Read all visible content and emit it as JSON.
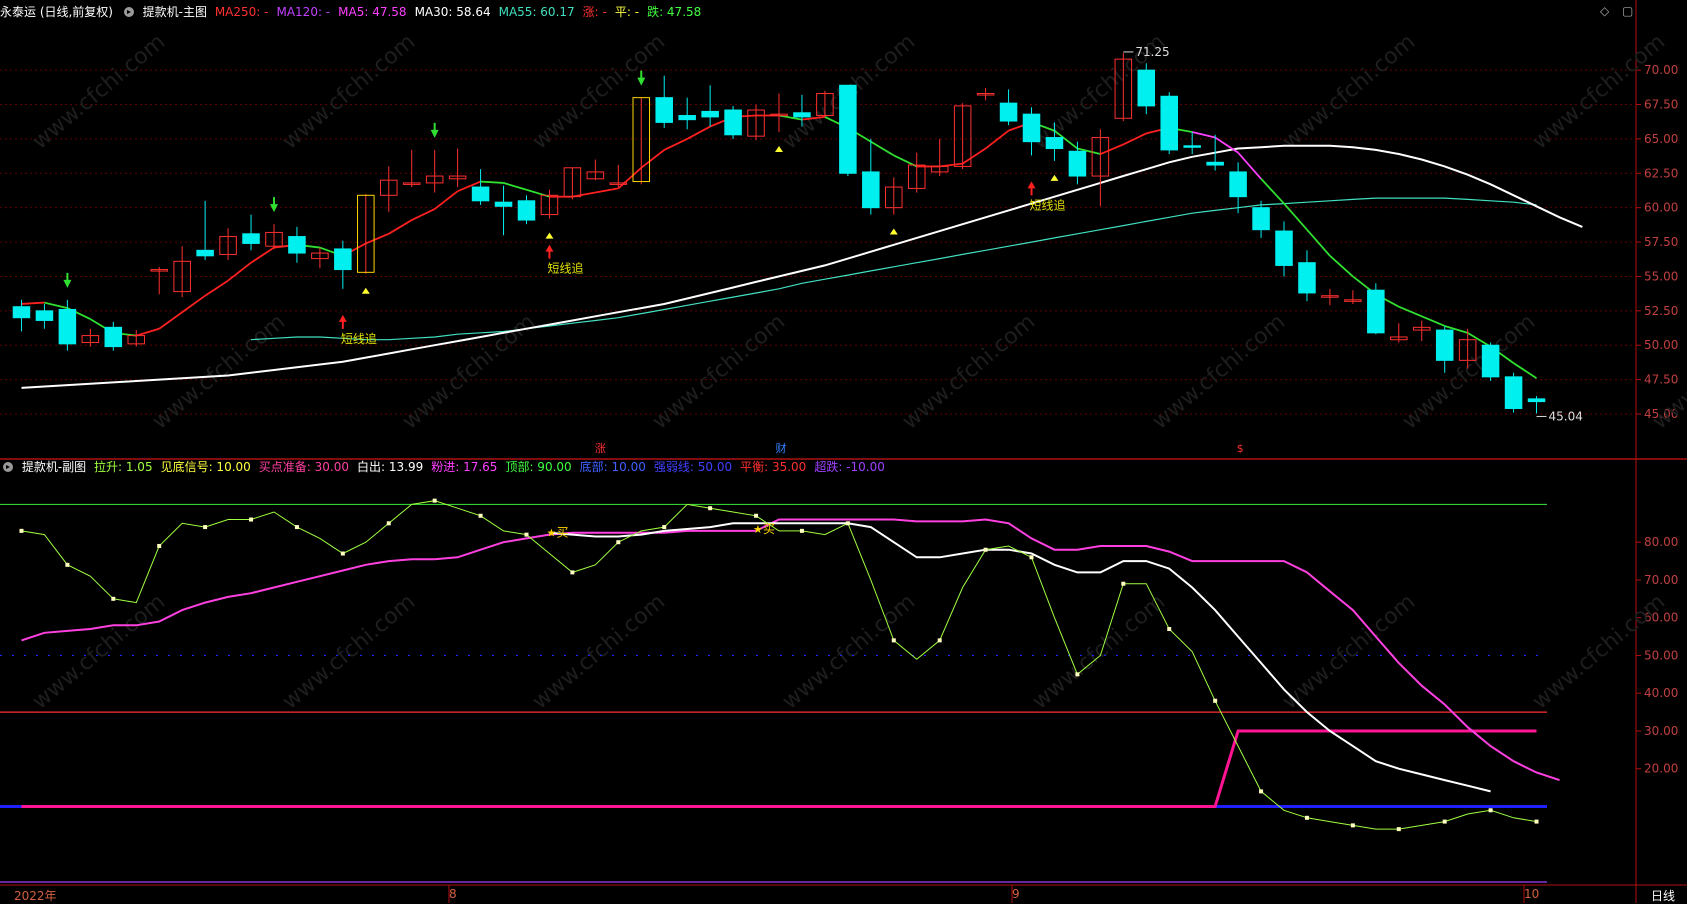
{
  "main_header": {
    "stock": "永泰运 (日线,前复权)",
    "indicator": "提款机-主图",
    "items": [
      {
        "text": "MA250: -",
        "color": "#ff3030"
      },
      {
        "text": "MA120: -",
        "color": "#c040ff"
      },
      {
        "text": "MA5: 47.58",
        "color": "#ff40ff"
      },
      {
        "text": "MA30: 58.64",
        "color": "#ffffff"
      },
      {
        "text": "MA55: 60.17",
        "color": "#40e0c0"
      },
      {
        "text": "涨: -",
        "color": "#ff3030"
      },
      {
        "text": "平: -",
        "color": "#ffff40"
      },
      {
        "text": "跌: 47.58",
        "color": "#40ff40"
      }
    ]
  },
  "sub_header": {
    "indicator": "提款机-副图",
    "items": [
      {
        "text": "拉升: 1.05",
        "color": "#a0ff40"
      },
      {
        "text": "见底信号: 10.00",
        "color": "#ffff40"
      },
      {
        "text": "买点准备: 30.00",
        "color": "#ff40a0"
      },
      {
        "text": "白出: 13.99",
        "color": "#ffffff"
      },
      {
        "text": "粉进: 17.65",
        "color": "#ff40ff"
      },
      {
        "text": "顶部: 90.00",
        "color": "#40ff40"
      },
      {
        "text": "底部: 10.00",
        "color": "#4060ff"
      },
      {
        "text": "强弱线: 50.00",
        "color": "#4040ff"
      },
      {
        "text": "平衡: 35.00",
        "color": "#ff3030"
      },
      {
        "text": "超跌: -10.00",
        "color": "#a040ff"
      }
    ]
  },
  "window_buttons": {
    "diamond": "◇",
    "restore": "▢"
  },
  "bottom_axis": {
    "year": "2022年",
    "m8": "8",
    "m9": "9",
    "m10": "10",
    "period": "日线"
  },
  "markers": {
    "zhang": "涨",
    "cai": "财",
    "s": "$"
  },
  "annotations": {
    "high": "71.25",
    "low": "45.04",
    "chase": "短线追",
    "buy": "买"
  },
  "watermark": "www.cfchi.com",
  "colors": {
    "up": "#ff3030",
    "down": "#00f0f0",
    "grid": "#600000",
    "axis": "#b01010",
    "tick": "#c04040"
  },
  "chart_data": [
    {
      "type": "candlestick",
      "title": "提款机-主图",
      "ylim": [
        41.8,
        73.5
      ],
      "y_ticks": [
        "70.00",
        "67.50",
        "65.00",
        "62.50",
        "60.00",
        "57.50",
        "55.00",
        "52.50",
        "50.00",
        "47.50",
        "45.00"
      ],
      "candles": [
        [
          52.8,
          52.0,
          53.3,
          51.0
        ],
        [
          52.5,
          51.8,
          53.0,
          51.2
        ],
        [
          52.6,
          50.1,
          53.3,
          49.6
        ],
        [
          50.2,
          50.7,
          51.2,
          49.9
        ],
        [
          51.3,
          49.9,
          51.7,
          49.6
        ],
        [
          50.1,
          50.7,
          51.1,
          49.9
        ],
        [
          55.5,
          55.5,
          55.7,
          53.7
        ],
        [
          53.9,
          56.1,
          57.2,
          53.5
        ],
        [
          56.9,
          56.5,
          60.5,
          56.2
        ],
        [
          56.6,
          57.9,
          58.5,
          56.2
        ],
        [
          58.1,
          57.4,
          59.5,
          56.9
        ],
        [
          57.2,
          58.2,
          58.8,
          57.0
        ],
        [
          57.9,
          56.7,
          58.6,
          56.0
        ],
        [
          56.3,
          56.7,
          57.1,
          55.6
        ],
        [
          57.0,
          55.5,
          57.6,
          54.1
        ],
        [
          55.3,
          60.9,
          61.0,
          55.2
        ],
        [
          60.9,
          62.0,
          63.0,
          59.7
        ],
        [
          61.7,
          61.8,
          64.2,
          61.5
        ],
        [
          61.8,
          62.3,
          64.2,
          61.1
        ],
        [
          62.1,
          62.3,
          64.3,
          61.5
        ],
        [
          61.5,
          60.5,
          62.8,
          60.2
        ],
        [
          60.4,
          60.1,
          61.6,
          58.0
        ],
        [
          60.5,
          59.1,
          60.9,
          58.8
        ],
        [
          59.5,
          60.9,
          61.3,
          59.2
        ],
        [
          60.8,
          62.9,
          62.9,
          60.6
        ],
        [
          62.1,
          62.6,
          63.5,
          62.0
        ],
        [
          61.8,
          61.8,
          63.1,
          61.5
        ],
        [
          61.9,
          68.0,
          68.0,
          61.7
        ],
        [
          68.0,
          66.2,
          69.6,
          65.8
        ],
        [
          66.7,
          66.4,
          68.0,
          65.7
        ],
        [
          67.0,
          66.6,
          68.9,
          65.9
        ],
        [
          67.1,
          65.3,
          67.4,
          65.0
        ],
        [
          65.2,
          67.1,
          67.5,
          64.9
        ],
        [
          66.7,
          66.8,
          68.3,
          65.5
        ],
        [
          66.9,
          66.6,
          68.2,
          65.9
        ],
        [
          66.7,
          68.3,
          68.5,
          66.6
        ],
        [
          68.9,
          62.5,
          68.9,
          62.3
        ],
        [
          62.6,
          60.0,
          65.0,
          59.5
        ],
        [
          60.0,
          61.5,
          62.2,
          59.5
        ],
        [
          61.4,
          63.1,
          64.0,
          61.1
        ],
        [
          62.6,
          63.0,
          65.0,
          62.3
        ],
        [
          63.0,
          67.4,
          67.6,
          62.8
        ],
        [
          68.3,
          68.3,
          68.7,
          67.8
        ],
        [
          67.6,
          66.3,
          68.6,
          66.0
        ],
        [
          66.8,
          64.8,
          67.3,
          63.8
        ],
        [
          65.1,
          64.3,
          66.2,
          63.4
        ],
        [
          64.1,
          62.3,
          64.8,
          61.7
        ],
        [
          62.3,
          65.1,
          65.7,
          60.1
        ],
        [
          66.5,
          70.8,
          71.25,
          66.3
        ],
        [
          70.0,
          67.4,
          70.5,
          66.8
        ],
        [
          68.1,
          64.2,
          68.4,
          63.9
        ],
        [
          64.5,
          64.4,
          65.5,
          63.9
        ],
        [
          63.3,
          63.1,
          65.3,
          62.7
        ],
        [
          62.6,
          60.8,
          63.3,
          59.6
        ],
        [
          60.0,
          58.4,
          60.5,
          57.8
        ],
        [
          58.3,
          55.8,
          59.0,
          55.0
        ],
        [
          56.0,
          53.8,
          56.9,
          53.2
        ],
        [
          53.5,
          53.6,
          54.1,
          52.9
        ],
        [
          53.2,
          53.3,
          54.0,
          53.0
        ],
        [
          54.0,
          50.9,
          54.5,
          50.8
        ],
        [
          50.4,
          50.6,
          51.6,
          50.2
        ],
        [
          51.1,
          51.3,
          51.8,
          50.3
        ],
        [
          51.1,
          48.9,
          51.4,
          48.0
        ],
        [
          48.9,
          50.4,
          51.2,
          48.3
        ],
        [
          50.0,
          47.7,
          50.2,
          47.4
        ],
        [
          47.7,
          45.4,
          48.0,
          45.1
        ],
        [
          46.1,
          45.9,
          46.3,
          45.04
        ]
      ],
      "series": [
        {
          "name": "MA5",
          "color_seq": true,
          "values": [
            53.0,
            53.1,
            52.7,
            51.9,
            50.9,
            50.7,
            51.2,
            52.4,
            53.6,
            54.7,
            56.0,
            57.1,
            57.3,
            57.1,
            56.5,
            57.4,
            58.1,
            59.1,
            59.9,
            61.2,
            61.9,
            61.8,
            61.3,
            60.8,
            60.8,
            61.1,
            61.4,
            62.9,
            64.2,
            65.0,
            65.9,
            66.6,
            66.7,
            66.7,
            66.4,
            66.6,
            65.8,
            64.8,
            63.8,
            63.0,
            63.0,
            63.2,
            64.3,
            65.6,
            66.2,
            65.6,
            64.3,
            63.9,
            64.6,
            65.4,
            65.8,
            65.5,
            65.1,
            64.0,
            62.1,
            60.3,
            58.4,
            56.5,
            55.0,
            53.7,
            52.8,
            52.1,
            51.4,
            50.9,
            49.9,
            48.7,
            47.6
          ]
        },
        {
          "name": "MA30",
          "color": "#ffffff",
          "values": [
            46.9,
            47.0,
            47.1,
            47.2,
            47.3,
            47.4,
            47.5,
            47.6,
            47.7,
            47.8,
            48.0,
            48.2,
            48.4,
            48.6,
            48.8,
            49.1,
            49.4,
            49.7,
            50.0,
            50.3,
            50.6,
            50.9,
            51.2,
            51.5,
            51.8,
            52.1,
            52.4,
            52.7,
            53.0,
            53.4,
            53.8,
            54.2,
            54.6,
            55.0,
            55.4,
            55.8,
            56.3,
            56.8,
            57.3,
            57.8,
            58.3,
            58.8,
            59.3,
            59.8,
            60.3,
            60.8,
            61.3,
            61.8,
            62.3,
            62.8,
            63.3,
            63.7,
            64.0,
            64.3,
            64.4,
            64.5,
            64.5,
            64.5,
            64.4,
            64.2,
            63.9,
            63.5,
            63.0,
            62.4,
            61.7,
            60.9,
            60.1,
            59.3,
            58.6
          ]
        },
        {
          "name": "MA55",
          "color": "#40e0c0",
          "values": [
            null,
            null,
            null,
            null,
            null,
            null,
            null,
            null,
            null,
            null,
            50.4,
            50.5,
            50.6,
            50.6,
            50.5,
            50.4,
            50.4,
            50.5,
            50.6,
            50.8,
            50.9,
            51.0,
            51.2,
            51.4,
            51.6,
            51.8,
            52.0,
            52.3,
            52.6,
            52.9,
            53.2,
            53.5,
            53.8,
            54.1,
            54.5,
            54.8,
            55.1,
            55.4,
            55.7,
            56.0,
            56.3,
            56.6,
            56.9,
            57.2,
            57.5,
            57.8,
            58.1,
            58.4,
            58.7,
            59.0,
            59.3,
            59.6,
            59.8,
            60.0,
            60.2,
            60.3,
            60.4,
            60.5,
            60.6,
            60.7,
            60.7,
            60.7,
            60.7,
            60.6,
            60.5,
            60.4,
            60.2
          ]
        }
      ],
      "labels": {
        "high": 71.25,
        "low": 45.04
      }
    },
    {
      "type": "line",
      "title": "提款机-副图",
      "ylim": [
        -10,
        97
      ],
      "y_ticks": [
        "80.00",
        "70.00",
        "60.00",
        "50.00",
        "40.00",
        "30.00",
        "20.00"
      ],
      "hlines": [
        {
          "name": "顶部",
          "value": 90,
          "color": "#30d030"
        },
        {
          "name": "强弱线",
          "value": 50,
          "color": "#2020ff",
          "dotted": true
        },
        {
          "name": "平衡",
          "value": 35,
          "color": "#ff3030"
        },
        {
          "name": "底部",
          "value": 10,
          "color": "#2020ff",
          "width": 3
        },
        {
          "name": "超跌",
          "value": -10,
          "color": "#a040ff"
        }
      ],
      "series": [
        {
          "name": "拉升",
          "color": "#a0ff40",
          "values": [
            83,
            82,
            74,
            71,
            65,
            64,
            79,
            85,
            84,
            86,
            86,
            88,
            84,
            81,
            77,
            80,
            85,
            90,
            91,
            89,
            87,
            83,
            82,
            77,
            72,
            74,
            80,
            83,
            84,
            90,
            89,
            88,
            87,
            83,
            83,
            82,
            85,
            70,
            54,
            49,
            54,
            68,
            78,
            79,
            76,
            60,
            45,
            50,
            69,
            69,
            57,
            51,
            38,
            26,
            14,
            9,
            7,
            6,
            5,
            4,
            4,
            5,
            6,
            8,
            9,
            7,
            6
          ]
        },
        {
          "name": "粉进",
          "color": "#ff40e0",
          "values": [
            54,
            56,
            56.5,
            57,
            58,
            58,
            59,
            62,
            64,
            65.5,
            66.5,
            68,
            69.5,
            71,
            72.5,
            74,
            75,
            75.5,
            75.5,
            76,
            78,
            80,
            81,
            82,
            82.5,
            82.5,
            82.5,
            82.5,
            82.5,
            83,
            83,
            83,
            83,
            86,
            86,
            86,
            86,
            86,
            86,
            85.5,
            85.5,
            85.5,
            86,
            85,
            81,
            78,
            78,
            79,
            79,
            79,
            77.5,
            75,
            75,
            75,
            75,
            75,
            72,
            67,
            62,
            55,
            48,
            42,
            37,
            31,
            26,
            22,
            19,
            17
          ]
        },
        {
          "name": "白出",
          "color": "#ffffff",
          "values": [
            null,
            null,
            null,
            null,
            null,
            null,
            null,
            null,
            null,
            null,
            null,
            null,
            null,
            null,
            null,
            null,
            null,
            null,
            null,
            null,
            null,
            null,
            null,
            82.5,
            82,
            81.5,
            81.5,
            82,
            83,
            83.5,
            84,
            85,
            85,
            85,
            85,
            85,
            85,
            84,
            80,
            76,
            76,
            77,
            78,
            78,
            77,
            74,
            72,
            72,
            75,
            75,
            73,
            68,
            62,
            55,
            48,
            41,
            35,
            30,
            26,
            22,
            20,
            18.5,
            17,
            15.5,
            14
          ]
        },
        {
          "name": "买点准备",
          "color": "#ff1493",
          "values": [
            10,
            10,
            10,
            10,
            10,
            10,
            10,
            10,
            10,
            10,
            10,
            10,
            10,
            10,
            10,
            10,
            10,
            10,
            10,
            10,
            10,
            10,
            10,
            10,
            10,
            10,
            10,
            10,
            10,
            10,
            10,
            10,
            10,
            10,
            10,
            10,
            10,
            10,
            10,
            10,
            10,
            10,
            10,
            10,
            10,
            10,
            10,
            10,
            10,
            10,
            10,
            10,
            10,
            30,
            30,
            30,
            30,
            30,
            30,
            30,
            30,
            30,
            30,
            30,
            30,
            30,
            30
          ]
        }
      ]
    }
  ]
}
